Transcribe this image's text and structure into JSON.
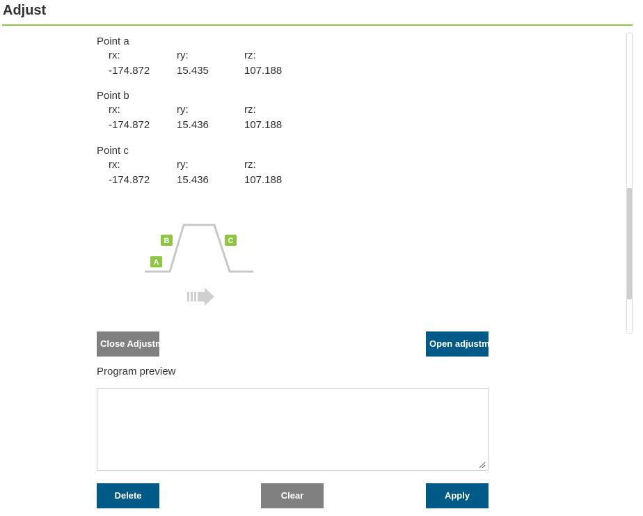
{
  "header": {
    "title": "Adjust"
  },
  "points": [
    {
      "label": "Point a",
      "rx_label": "rx:",
      "ry_label": "ry:",
      "rz_label": "rz:",
      "rx": "-174.872",
      "ry": "15.435",
      "rz": "107.188"
    },
    {
      "label": "Point b",
      "rx_label": "rx:",
      "ry_label": "ry:",
      "rz_label": "rz:",
      "rx": "-174.872",
      "ry": "15.436",
      "rz": "107.188"
    },
    {
      "label": "Point c",
      "rx_label": "rx:",
      "ry_label": "ry:",
      "rz_label": "rz:",
      "rx": "-174.872",
      "ry": "15.436",
      "rz": "107.188"
    }
  ],
  "diagram": {
    "markers": [
      "A",
      "B",
      "C"
    ],
    "accent_color": "#8dc63f",
    "line_color": "#c8c8c8"
  },
  "actions": {
    "close_label": "Close Adjustment",
    "open_label": "Open adjustment"
  },
  "preview": {
    "label": "Program preview",
    "value": ""
  },
  "footer": {
    "delete_label": "Delete",
    "clear_label": "Clear",
    "apply_label": "Apply"
  },
  "colors": {
    "primary_button": "#005a87",
    "secondary_button": "#808080",
    "accent": "#8dc63f"
  }
}
